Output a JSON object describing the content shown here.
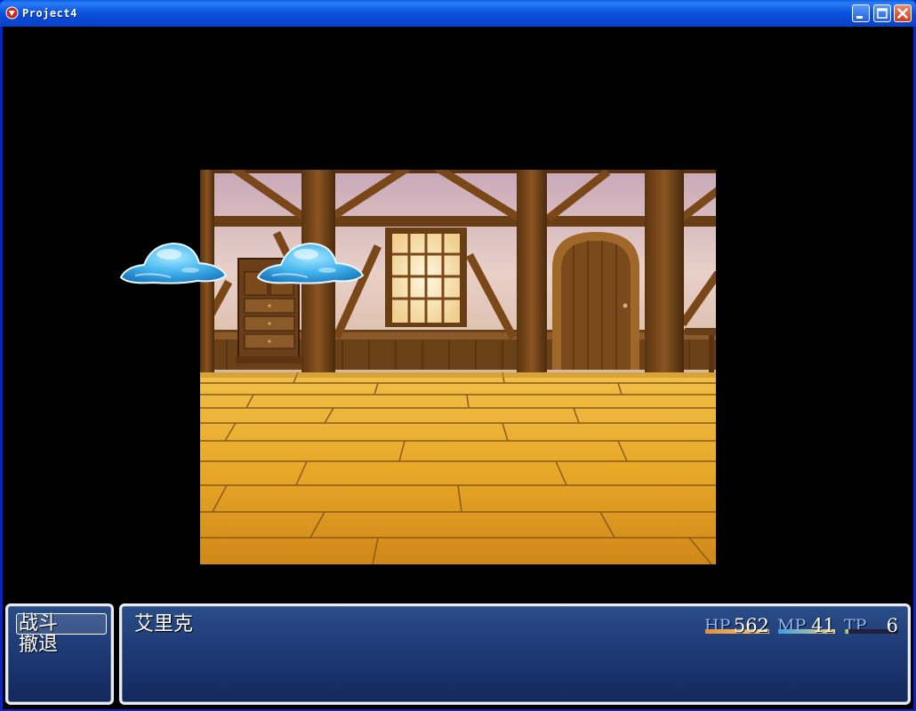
{
  "window": {
    "title": "Project4",
    "title_color": "#ffffff",
    "titlebar_color": "#0a56e0"
  },
  "battle": {
    "enemies": [
      {
        "name": "slime",
        "icon": "slime-icon"
      },
      {
        "name": "slime",
        "icon": "slime-icon"
      }
    ]
  },
  "command_window": {
    "items": [
      {
        "label": "战斗",
        "selected": true
      },
      {
        "label": "撤退",
        "selected": false
      }
    ]
  },
  "status_window": {
    "actor": {
      "name": "艾里克",
      "hp_label": "HP",
      "hp": "562",
      "hp_fill": 1.0,
      "mp_label": "MP",
      "mp": "41",
      "mp_fill": 1.0,
      "tp_label": "TP",
      "tp": "6",
      "tp_fill": 0.06
    }
  },
  "colors": {
    "hp_gauge": "#e0903a",
    "mp_gauge": "#3aa0e0",
    "tp_gauge": "#40c070",
    "window_bg": "#1f3c78",
    "label_color": "#8cb8ff"
  }
}
